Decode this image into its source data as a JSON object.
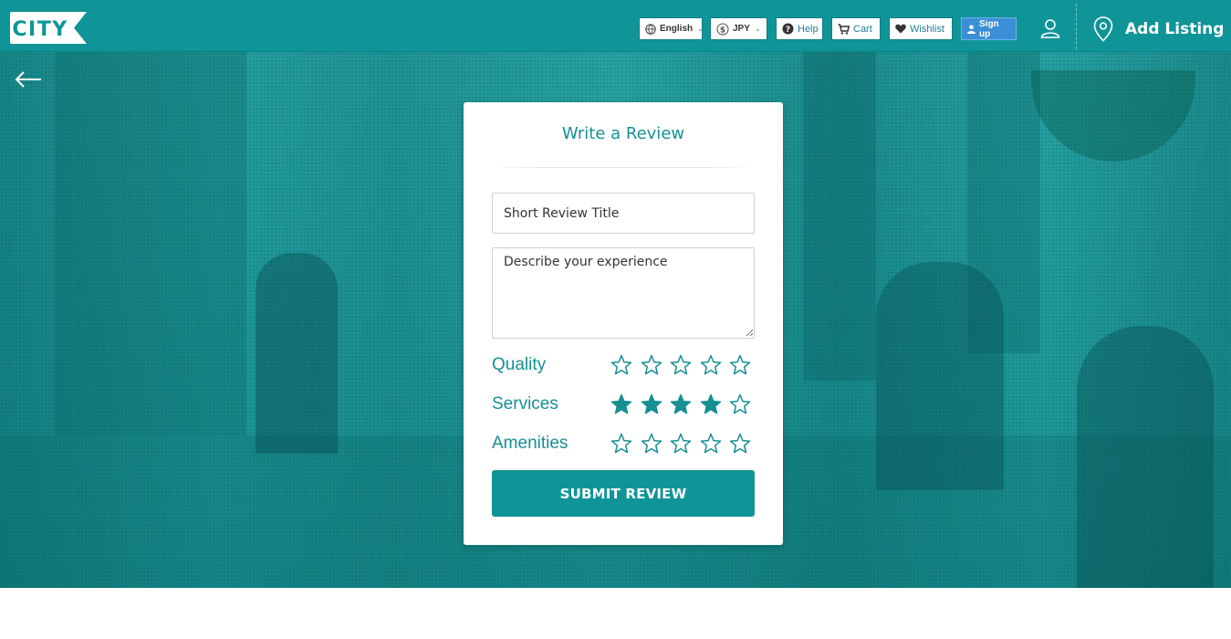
{
  "header": {
    "logo_text": "CITY",
    "language": {
      "label": "English",
      "icon": "globe-icon"
    },
    "currency": {
      "label": "JPY",
      "icon": "dollar-circle-icon"
    },
    "help_label": "Help",
    "cart_label": "Cart",
    "wishlist_label": "Wishlist",
    "signup_label": "Sign up",
    "add_listing_label": "Add Listing",
    "brand_color": "#0f9598"
  },
  "review_form": {
    "title": "Write a Review",
    "review_title_placeholder": "Short Review Title",
    "description_placeholder": "Describe your experience",
    "ratings": [
      {
        "label": "Quality",
        "value": 0,
        "max": 5
      },
      {
        "label": "Services",
        "value": 4,
        "max": 5
      },
      {
        "label": "Amenities",
        "value": 0,
        "max": 5
      }
    ],
    "submit_label": "SUBMIT REVIEW",
    "accent_color": "#168f94"
  }
}
